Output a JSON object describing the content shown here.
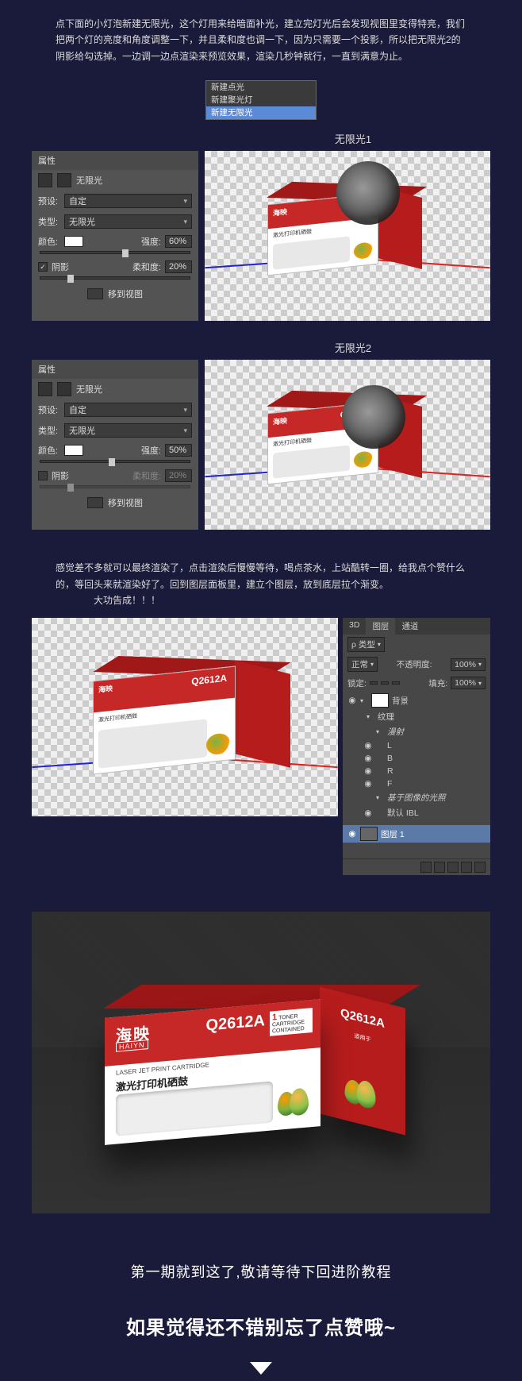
{
  "intro": "点下面的小灯泡新建无限光，这个灯用来给暗面补光，建立完灯光后会发现视图里变得特亮，我们把两个灯的亮度和角度调整一下，并且柔和度也调一下，因为只需要一个投影，所以把无限光2的阴影给勾选掉。一边调一边点渲染来预览效果，渲染几秒钟就行，一直到满意为止。",
  "menu": {
    "a": "新建点光",
    "b": "新建聚光灯",
    "c": "新建无限光"
  },
  "stage1": "无限光1",
  "stage2": "无限光2",
  "panel": {
    "head": "属性",
    "name": "无限光",
    "preset_l": "预设:",
    "preset_v": "自定",
    "type_l": "类型:",
    "type_v": "无限光",
    "color_l": "颜色:",
    "intensity_l": "强度:",
    "shadow_l": "阴影",
    "soft_l": "柔和度:",
    "move": "移到视图"
  },
  "p1": {
    "intensity": "60%",
    "soft": "20%",
    "shadow": true
  },
  "p2": {
    "intensity": "50%",
    "soft": "20%",
    "shadow": false
  },
  "mid": "感觉差不多就可以最终渲染了，点击渲染后慢慢等待，喝点茶水，上站酷转一圈，给我点个赞什么的，等回头来就渲染好了。回到图层面板里，建立个图层，放到底层拉个渐变。",
  "done": "大功告成！！！",
  "layers": {
    "tab1": "3D",
    "tab2": "图层",
    "tab3": "通道",
    "kind_l": "ρ 类型",
    "mode": "正常",
    "opacity_l": "不透明度:",
    "opacity_v": "100%",
    "lock_l": "锁定:",
    "fill_l": "填充:",
    "fill_v": "100%",
    "bg": "背景",
    "grp_tex": "纹理",
    "li_diff": "漫射",
    "li_l": "L",
    "li_b": "B",
    "li_r": "R",
    "li_f": "F",
    "li_shadow": "基于图像的光照",
    "li_def": "默认 IBL",
    "layer1": "图层 1"
  },
  "box": {
    "brand": "海映",
    "brand_e": "HAIYN",
    "model": "Q2612A",
    "tc_n": "1",
    "tc1": "TONER CARTRIDGE",
    "tc2": "CONTAINED",
    "sub1": "LASER JET PRINT CARTRIDGE",
    "sub2": "激光打印机硒鼓",
    "side_sub": "适用于"
  },
  "close1": "第一期就到这了,敬请等待下回进阶教程",
  "close2": "如果觉得还不错别忘了点赞哦~"
}
